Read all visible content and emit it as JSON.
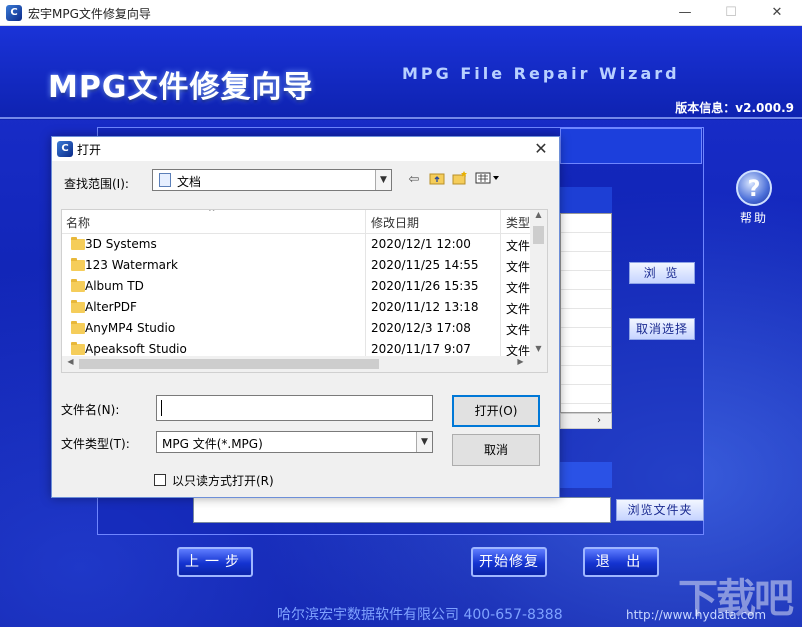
{
  "window": {
    "title": "宏宇MPG文件修复向导",
    "icon": "app-logo-icon",
    "minimize": "—",
    "maximize": "☐",
    "close": "✕"
  },
  "banner": {
    "title_cn": "MPG文件修复向导",
    "title_en": "MPG File Repair Wizard",
    "version": "版本信息：v2.000.9"
  },
  "help": {
    "icon": "?",
    "label": "帮助"
  },
  "side_buttons": {
    "browse": "浏 览",
    "cancel_select": "取消选择",
    "browse_folder": "浏览文件夹"
  },
  "nav": {
    "prev": "上一步",
    "start": "开始修复",
    "exit": "退 出"
  },
  "footer": {
    "company": "哈尔滨宏宇数据软件有限公司   400-657-8388",
    "url": "http://www.hydata.com",
    "watermark": "下载吧"
  },
  "dialog": {
    "title": "打开",
    "lookin_label": "查找范围(I):",
    "lookin_value": "文档",
    "toolbar_icons": [
      "back-arrow-icon",
      "up-folder-icon",
      "new-folder-icon",
      "view-menu-icon"
    ],
    "columns": {
      "name": "名称",
      "date": "修改日期",
      "type": "类型"
    },
    "files": [
      {
        "name": "3D Systems",
        "date": "2020/12/1 12:00",
        "type": "文件"
      },
      {
        "name": "123 Watermark",
        "date": "2020/11/25 14:55",
        "type": "文件"
      },
      {
        "name": "Album TD",
        "date": "2020/11/26 15:35",
        "type": "文件"
      },
      {
        "name": "AlterPDF",
        "date": "2020/11/12 13:18",
        "type": "文件"
      },
      {
        "name": "AnyMP4 Studio",
        "date": "2020/12/3 17:08",
        "type": "文件"
      },
      {
        "name": "Apeaksoft Studio",
        "date": "2020/11/17 9:07",
        "type": "文件"
      }
    ],
    "filename_label": "文件名(N):",
    "filename_value": "",
    "filetype_label": "文件类型(T):",
    "filetype_value": "MPG 文件(*.MPG)",
    "open_button": "打开(O)",
    "cancel_button": "取消",
    "readonly_label": "以只读方式打开(R)",
    "readonly_checked": false
  },
  "colors": {
    "app_blue": "#1226b8",
    "accent": "#0078d7"
  }
}
